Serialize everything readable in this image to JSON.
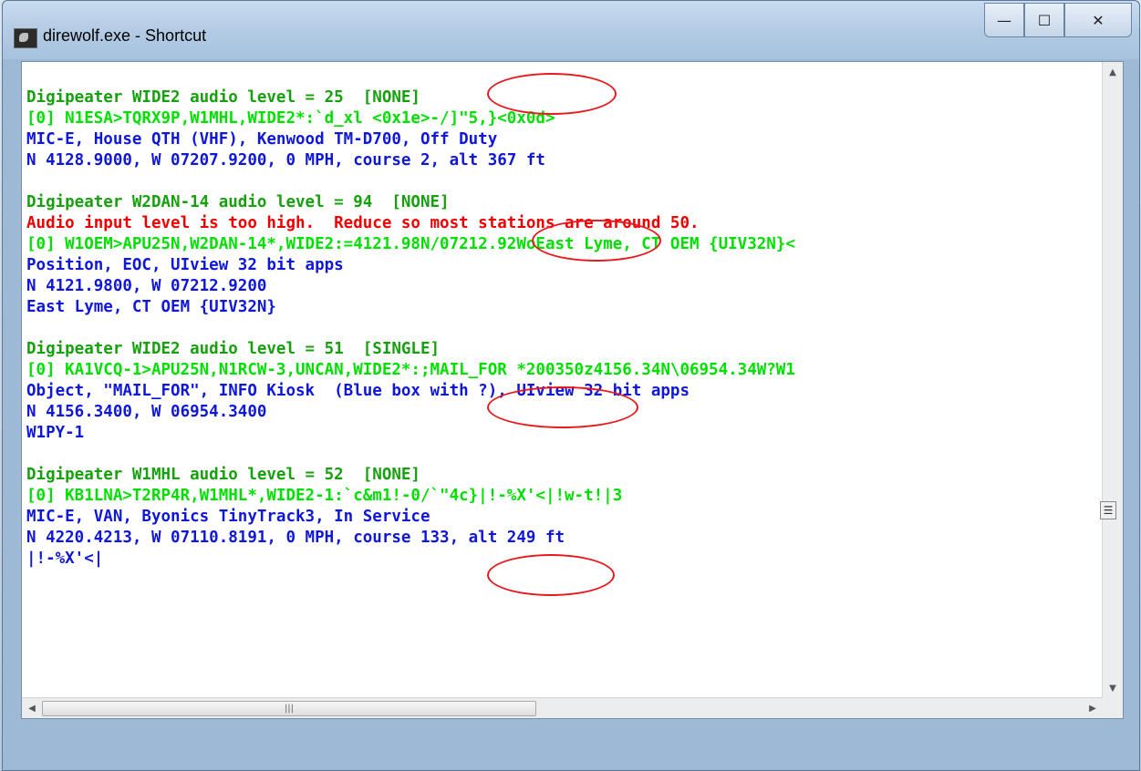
{
  "window": {
    "title": "direwolf.exe - Shortcut"
  },
  "controls": {
    "minimize": "—",
    "maximize": "☐",
    "close": "✕"
  },
  "console": {
    "lines": [
      {
        "text": "Digipeater WIDE2 audio level = 25  [NONE]",
        "color": "green"
      },
      {
        "text": "[0] N1ESA>TQRX9P,W1MHL,WIDE2*:`d_xl <0x1e>-/]\"5,}<0x0d>",
        "color": "bgreen"
      },
      {
        "text": "MIC-E, House QTH (VHF), Kenwood TM-D700, Off Duty",
        "color": "blue"
      },
      {
        "text": "N 4128.9000, W 07207.9200, 0 MPH, course 2, alt 367 ft",
        "color": "blue"
      },
      {
        "text": "",
        "color": "blank"
      },
      {
        "text": "Digipeater W2DAN-14 audio level = 94  [NONE]",
        "color": "green"
      },
      {
        "text": "Audio input level is too high.  Reduce so most stations are around 50.",
        "color": "red"
      },
      {
        "text": "[0] W1OEM>APU25N,W2DAN-14*,WIDE2:=4121.98N/07212.92WoEast Lyme, CT OEM {UIV32N}<",
        "color": "bgreen"
      },
      {
        "text": "Position, EOC, UIview 32 bit apps",
        "color": "blue"
      },
      {
        "text": "N 4121.9800, W 07212.9200",
        "color": "blue"
      },
      {
        "text": "East Lyme, CT OEM {UIV32N}",
        "color": "blue"
      },
      {
        "text": "",
        "color": "blank"
      },
      {
        "text": "Digipeater WIDE2 audio level = 51  [SINGLE]",
        "color": "green"
      },
      {
        "text": "[0] KA1VCQ-1>APU25N,N1RCW-3,UNCAN,WIDE2*:;MAIL_FOR *200350z4156.34N\\06954.34W?W1",
        "color": "bgreen"
      },
      {
        "text": "Object, \"MAIL_FOR\", INFO Kiosk  (Blue box with ?), UIview 32 bit apps",
        "color": "blue"
      },
      {
        "text": "N 4156.3400, W 06954.3400",
        "color": "blue"
      },
      {
        "text": "W1PY-1",
        "color": "blue"
      },
      {
        "text": "",
        "color": "blank"
      },
      {
        "text": "Digipeater W1MHL audio level = 52  [NONE]",
        "color": "green"
      },
      {
        "text": "[0] KB1LNA>T2RP4R,W1MHL*,WIDE2-1:`c&m1!-0/`\"4c}|!-%X'<|!w-t!|3",
        "color": "bgreen"
      },
      {
        "text": "MIC-E, VAN, Byonics TinyTrack3, In Service",
        "color": "blue"
      },
      {
        "text": "N 4220.4213, W 07110.8191, 0 MPH, course 133, alt 249 ft",
        "color": "blue"
      },
      {
        "text": "|!-%X'<|",
        "color": "blue"
      }
    ]
  },
  "scrollbar": {
    "thumb_grip": "|||"
  }
}
